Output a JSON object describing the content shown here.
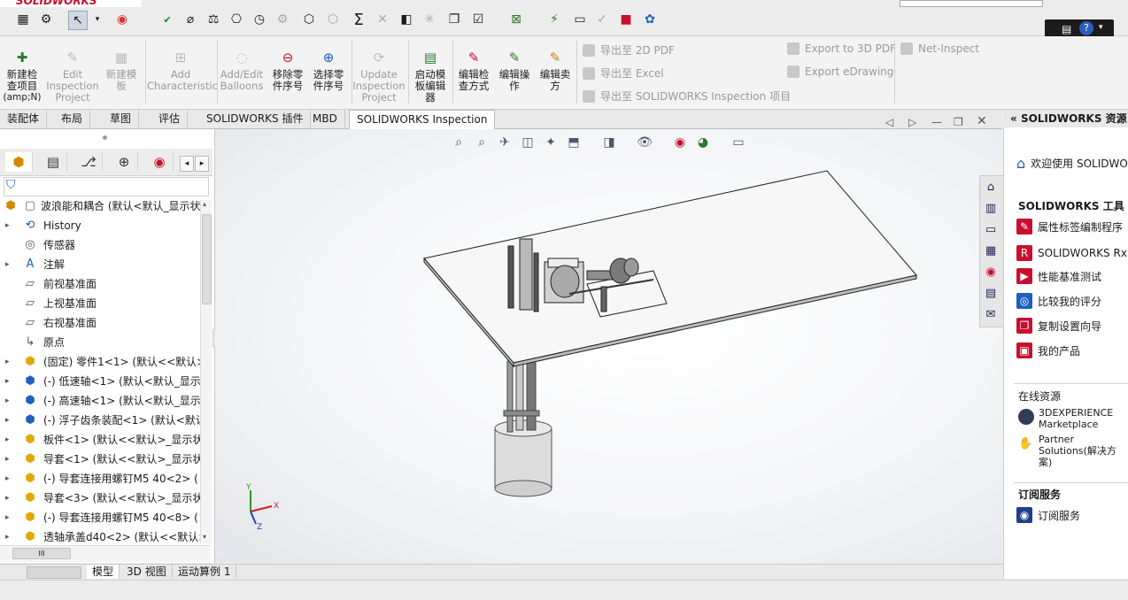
{
  "app": {
    "brand": "SOLIDWORKS"
  },
  "command_manager": {
    "buttons": [
      {
        "label": "新建检查项目(amp;N)",
        "lines": [
          "新建检",
          "查项目",
          "(amp;N)"
        ],
        "enabled": true
      },
      {
        "label": "Edit Inspection Project",
        "lines": [
          "Edit",
          "Inspection",
          "Project"
        ],
        "enabled": false
      },
      {
        "label": "新建模板",
        "lines": [
          "新建模",
          "板"
        ],
        "enabled": false
      },
      {
        "label": "Add Characteristic",
        "lines": [
          "Add",
          "Characteristic"
        ],
        "enabled": false
      },
      {
        "label": "Add/Edit Balloons",
        "lines": [
          "Add/Edit",
          "Balloons"
        ],
        "enabled": false
      },
      {
        "label": "移除零件序号",
        "lines": [
          "移除零",
          "件序号"
        ],
        "enabled": true
      },
      {
        "label": "选择零件序号",
        "lines": [
          "选择零",
          "件序号"
        ],
        "enabled": true
      },
      {
        "label": "Update Inspection Project",
        "lines": [
          "Update",
          "Inspection",
          "Project"
        ],
        "enabled": false
      },
      {
        "label": "启动模板编辑器",
        "lines": [
          "启动模",
          "板编辑",
          "器"
        ],
        "enabled": true
      },
      {
        "label": "编辑检查方式",
        "lines": [
          "编辑检",
          "查方式"
        ],
        "enabled": true
      },
      {
        "label": "编辑操作",
        "lines": [
          "编辑操",
          "作"
        ],
        "enabled": true
      },
      {
        "label": "编辑卖方",
        "lines": [
          "编辑卖",
          "方"
        ],
        "enabled": true
      }
    ],
    "exports": [
      "导出至 2D PDF",
      "导出至 Excel",
      "导出至 SOLIDWORKS Inspection 项目",
      "Export to 3D PDF",
      "Export eDrawing",
      "Net-Inspect"
    ]
  },
  "tabs": [
    "装配体",
    "布局",
    "草图",
    "评估",
    "SOLIDWORKS 插件",
    "MBD",
    "SOLIDWORKS Inspection"
  ],
  "active_tab": "SOLIDWORKS Inspection",
  "feature_tree": {
    "root": "波浪能和耦合 (默认<默认_显示状",
    "items": [
      {
        "label": "History",
        "icon": "history-icon",
        "expandable": true
      },
      {
        "label": "传感器",
        "icon": "sensor-icon",
        "expandable": false
      },
      {
        "label": "注解",
        "icon": "annotation-icon",
        "expandable": true
      },
      {
        "label": "前视基准面",
        "icon": "plane-icon",
        "expandable": false
      },
      {
        "label": "上视基准面",
        "icon": "plane-icon",
        "expandable": false
      },
      {
        "label": "右视基准面",
        "icon": "plane-icon",
        "expandable": false
      },
      {
        "label": "原点",
        "icon": "origin-icon",
        "expandable": false
      },
      {
        "label": "(固定) 零件1<1> (默认<<默认>",
        "icon": "part-icon",
        "expandable": true
      },
      {
        "label": "(-) 低速轴<1> (默认<默认_显示",
        "icon": "subassembly-icon",
        "expandable": true
      },
      {
        "label": "(-) 高速轴<1> (默认<默认_显示",
        "icon": "subassembly-icon",
        "expandable": true
      },
      {
        "label": "(-) 浮子齿条装配<1> (默认<默认",
        "icon": "subassembly-icon",
        "expandable": true
      },
      {
        "label": "板件<1> (默认<<默认>_显示状",
        "icon": "part-icon",
        "expandable": true
      },
      {
        "label": "导套<1> (默认<<默认>_显示状",
        "icon": "part-icon",
        "expandable": true
      },
      {
        "label": "(-) 导套连接用螺钉M5 40<2> (",
        "icon": "part-icon",
        "expandable": true
      },
      {
        "label": "导套<3> (默认<<默认>_显示状",
        "icon": "part-icon",
        "expandable": true
      },
      {
        "label": "(-) 导套连接用螺钉M5 40<8> (",
        "icon": "part-icon",
        "expandable": true
      },
      {
        "label": "透轴承盖d40<2> (默认<<默认>",
        "icon": "part-icon",
        "expandable": true
      }
    ]
  },
  "scrollbar_label": "III",
  "bottom_tabs": [
    "模型",
    "3D 视图",
    "运动算例 1"
  ],
  "active_bottom_tab": "模型",
  "right_panel": {
    "title": "SOLIDWORKS 资源",
    "welcome": "欢迎使用 SOLIDWORKS",
    "tools_heading": "SOLIDWORKS 工具",
    "tools": [
      "属性标签编制程序",
      "SOLIDWORKS Rx",
      "性能基准测试",
      "比较我的评分",
      "复制设置向导",
      "我的产品"
    ],
    "online_heading": "在线资源",
    "online": [
      "3DEXPERIENCE Marketplace",
      "Partner Solutions(解决方案)"
    ],
    "subscription_heading": "订阅服务",
    "subscription": [
      "订阅服务"
    ]
  },
  "triad": {
    "x": "X",
    "y": "Y",
    "z": "Z"
  },
  "colors": {
    "brand": "#c8102e",
    "accent": "#1f5fbf"
  }
}
